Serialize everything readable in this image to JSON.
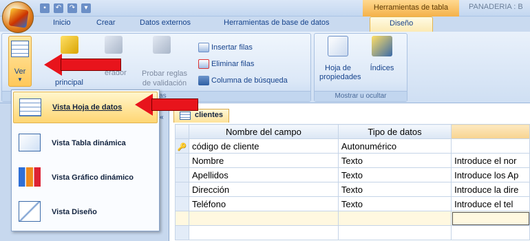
{
  "window": {
    "context_tab": "Herramientas de tabla",
    "title": "PANADERIA : B"
  },
  "tabs": [
    "Inicio",
    "Crear",
    "Datos externos",
    "Herramientas de base de datos",
    "Diseño"
  ],
  "ribbon": {
    "ver_label": "Ver",
    "clave_label": "principal",
    "generador_label": "erador",
    "probar_reglas_line1": "Probar reglas",
    "probar_reglas_line2": "de validación",
    "insertar_filas": "Insertar filas",
    "eliminar_filas": "Eliminar filas",
    "columna_busqueda": "Columna de búsqueda",
    "herramientas_group": "ientas",
    "hoja_propiedades_line1": "Hoja de",
    "hoja_propiedades_line2": "propiedades",
    "indices": "Índices",
    "mostrar_group": "Mostrar u ocultar"
  },
  "view_menu": {
    "items": [
      {
        "label": "Vista Hoja de datos",
        "icon": "datasheet-view-icon"
      },
      {
        "label": "Vista Tabla dinámica",
        "icon": "pivot-table-icon"
      },
      {
        "label": "Vista Gráfico dinámico",
        "icon": "pivot-chart-icon"
      },
      {
        "label": "Vista Diseño",
        "icon": "design-view-icon"
      }
    ]
  },
  "document": {
    "tab_label": "clientes",
    "columns": [
      "Nombre del campo",
      "Tipo de datos",
      ""
    ],
    "rows": [
      {
        "field": "código de cliente",
        "type": "Autonumérico",
        "desc": "",
        "key": true
      },
      {
        "field": "Nombre",
        "type": "Texto",
        "desc": "Introduce el nor"
      },
      {
        "field": "Apellidos",
        "type": "Texto",
        "desc": "Introduce los Ap"
      },
      {
        "field": "Dirección",
        "type": "Texto",
        "desc": "Introduce la dire"
      },
      {
        "field": "Teléfono",
        "type": "Texto",
        "desc": "Introduce el tel"
      }
    ]
  },
  "colors": {
    "arrow": "#e8141c",
    "menu_highlight": "#ffd673",
    "ribbon_bg": "#dce8f7"
  }
}
